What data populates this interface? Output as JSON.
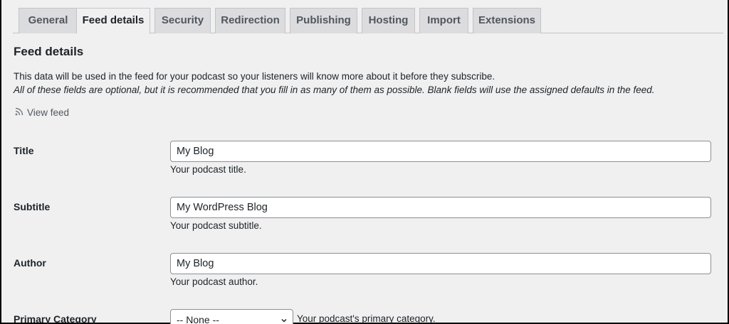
{
  "tabs": [
    "General",
    "Feed details",
    "Security",
    "Redirection",
    "Publishing",
    "Hosting",
    "Import",
    "Extensions"
  ],
  "active_tab": "Feed details",
  "section": {
    "title": "Feed details",
    "description": "This data will be used in the feed for your podcast so your listeners will know more about it before they subscribe.",
    "note": "All of these fields are optional, but it is recommended that you fill in as many of them as possible. Blank fields will use the assigned defaults in the feed.",
    "view_feed_label": "View feed"
  },
  "fields": {
    "title": {
      "label": "Title",
      "value": "My Blog",
      "help": "Your podcast title."
    },
    "subtitle": {
      "label": "Subtitle",
      "value": "My WordPress Blog",
      "help": "Your podcast subtitle."
    },
    "author": {
      "label": "Author",
      "value": "My Blog",
      "help": "Your podcast author."
    },
    "primary_category": {
      "label": "Primary Category",
      "selected": "-- None --",
      "help": "Your podcast's primary category."
    }
  },
  "icons": {
    "view_feed": "rss-icon",
    "select": "chevron-down-icon"
  },
  "colors": {
    "background": "#f0f0f1",
    "tab_inactive": "#dcdcde",
    "border": "#c3c4c7",
    "input_border": "#8c8f94"
  }
}
